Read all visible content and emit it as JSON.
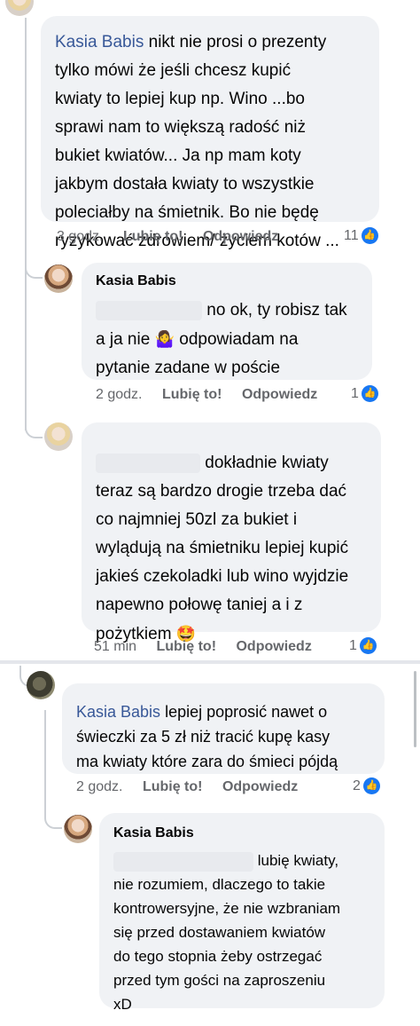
{
  "comments": [
    {
      "id": "c1",
      "mention": "Kasia Babis",
      "lines": [
        " nikt nie prosi o prezenty",
        "tylko mówi że jeśli chcesz kupić",
        "kwiaty to lepiej kup np. Wino ...bo",
        "sprawi nam to większą radość niż",
        "bukiet kwiatów... Ja np mam koty",
        "jakbym dostała kwiaty to wszystkie",
        "poleciałby na śmietnik. Bo nie będę",
        "ryzykować zdrowiem/ życiem kotów ..."
      ],
      "time": "3 godz.",
      "like": "Lubię to!",
      "reply": "Odpowiedz",
      "reactions": "11"
    },
    {
      "id": "c2",
      "author": "Kasia Babis",
      "lines": [
        "no ok, ty robisz tak",
        "a ja nie",
        "odpowiadam na",
        "pytanie zadane w poście"
      ],
      "emoji": "🤷‍♀️",
      "time": "2 godz.",
      "like": "Lubię to!",
      "reply": "Odpowiedz",
      "reactions": "1"
    },
    {
      "id": "c3",
      "lines": [
        "dokładnie kwiaty",
        "teraz są bardzo drogie trzeba dać",
        "co najmniej 50zl za bukiet i",
        "wylądują na śmietniku lepiej kupić",
        "jakieś czekoladki lub wino wyjdzie",
        "napewno połowę taniej a i  z",
        "pożytkiem"
      ],
      "emoji": "🤩",
      "time": "51 min",
      "like": "Lubię to!",
      "reply": "Odpowiedz",
      "reactions": "1"
    },
    {
      "id": "c4",
      "mention": "Kasia Babis",
      "lines": [
        " lepiej poprosić  nawet o",
        "świeczki za 5 zł  niż  tracić kupę kasy",
        "ma kwiaty które  zara do śmieci  pójdą"
      ],
      "time": "2 godz.",
      "like": "Lubię to!",
      "reply": "Odpowiedz",
      "reactions": "2"
    },
    {
      "id": "c5",
      "author": "Kasia Babis",
      "lines": [
        "lubię kwiaty,",
        "nie rozumiem, dlaczego  to takie",
        "kontrowersyjne, że nie wzbraniam",
        "się przed dostawaniem kwiatów",
        "do tego stopnia żeby ostrzegać",
        "przed tym gości na zaproszeniu",
        "xD"
      ]
    }
  ],
  "colors": {
    "link": "#385898",
    "bubble": "#f0f2f5",
    "like": "#1877f2",
    "meta": "#65676b"
  },
  "icons": {
    "reaction": "like-icon",
    "avatar": "avatar"
  }
}
